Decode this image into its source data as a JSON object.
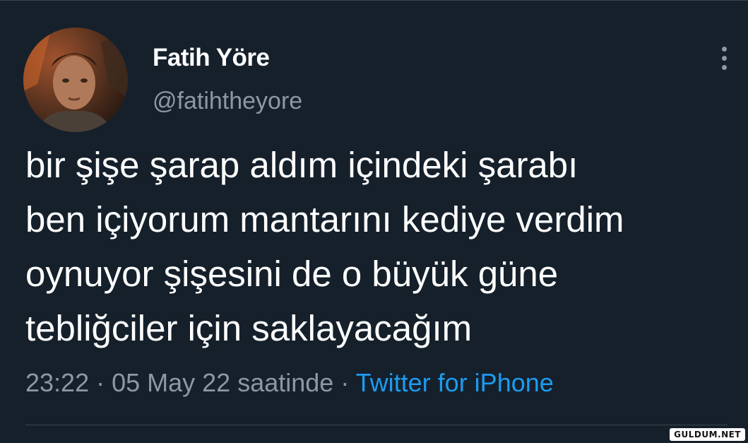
{
  "tweet": {
    "display_name": "Fatih Yöre",
    "handle": "@fatihtheyore",
    "text": "bir şişe şarap aldım içindeki şarabı\nben içiyorum mantarını kediye verdim\noynuyor şişesini de o büyük güne\ntebliğciler için saklayacağım",
    "time": "23:22",
    "separator": " · ",
    "date": "05 May 22 saatinde",
    "source": "Twitter for iPhone"
  },
  "watermark": "GULDUM.NET",
  "colors": {
    "background": "#15202b",
    "text": "#ffffff",
    "secondary": "#8b98a5",
    "accent": "#1d9bf0",
    "divider": "#38444d"
  },
  "icons": {
    "more": "more-vertical-icon"
  }
}
